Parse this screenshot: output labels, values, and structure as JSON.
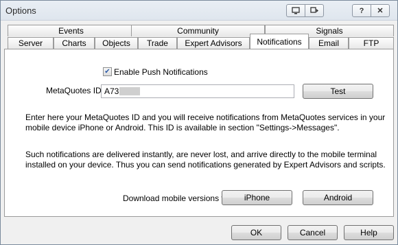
{
  "window": {
    "title": "Options"
  },
  "titlebar": {
    "btn_monitor_icon": "monitor-icon",
    "btn_restore_icon": "restore-icon",
    "help_glyph": "?",
    "close_glyph": "✕"
  },
  "tabs": {
    "top_row": [
      "Events",
      "Community",
      "Signals"
    ],
    "bottom_row": [
      "Server",
      "Charts",
      "Objects",
      "Trade",
      "Expert Advisors",
      "Notifications",
      "Email",
      "FTP"
    ],
    "active": "Notifications"
  },
  "notifications": {
    "enable_push_label": "Enable Push Notifications",
    "enable_push_checked": true,
    "metaquotes_id_label": "MetaQuotes ID",
    "metaquotes_id_value": "A73",
    "test_button": "Test",
    "info_paragraph_1": "Enter here your MetaQuotes ID and you will receive notifications from MetaQuotes services in your mobile device iPhone or Android. This ID is available in section \"Settings->Messages\".",
    "info_paragraph_2": "Such notifications are delivered instantly, are never lost, and arrive directly to the mobile terminal installed on your device. Thus you can send notifications generated by Expert Advisors and scripts.",
    "download_label": "Download mobile versions for:",
    "iphone_button": "iPhone",
    "android_button": "Android"
  },
  "footer": {
    "ok_button": "OK",
    "cancel_button": "Cancel",
    "help_button": "Help"
  }
}
